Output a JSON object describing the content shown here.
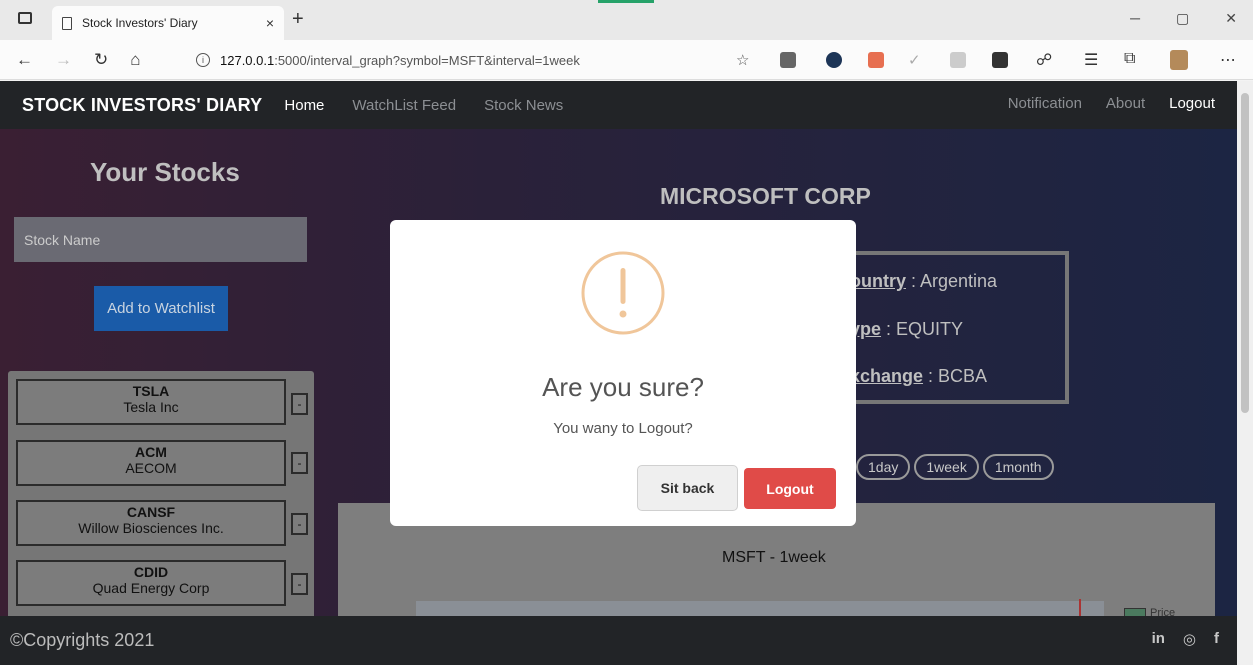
{
  "browser": {
    "tab_title": "Stock Investors' Diary",
    "tab_close": "×",
    "new_tab": "+",
    "url_host": "127.0.0.1",
    "url_path": ":5000/interval_graph?symbol=MSFT&interval=1week",
    "min": "─",
    "max": "▢",
    "close": "✕"
  },
  "navbar": {
    "brand": "STOCK INVESTORS' DIARY",
    "home": "Home",
    "watchlist_feed": "WatchList Feed",
    "stock_news": "Stock News",
    "notification": "Notification",
    "about": "About",
    "logout": "Logout"
  },
  "sidebar": {
    "title": "Your Stocks",
    "input_placeholder": "Stock Name",
    "add_button": "Add to Watchlist",
    "remove_label": "-",
    "items": [
      {
        "symbol": "TSLA",
        "name": "Tesla Inc"
      },
      {
        "symbol": "ACM",
        "name": "AECOM"
      },
      {
        "symbol": "CANSF",
        "name": "Willow Biosciences Inc."
      },
      {
        "symbol": "CDID",
        "name": "Quad Energy Corp"
      }
    ]
  },
  "stock": {
    "company": "MICROSOFT CORP",
    "country_key": "ountry",
    "country_val": " : Argentina",
    "type_key": "ype",
    "type_val": " : EQUITY",
    "exchange_key": "xchange",
    "exchange_val": " : BCBA",
    "intervals": [
      "1day",
      "1week",
      "1month"
    ]
  },
  "chart": {
    "title": "MSFT - 1week",
    "legend": "Price"
  },
  "footer": {
    "copyright": "©Copyrights 2021",
    "social": [
      "in",
      "◎",
      "f"
    ]
  },
  "modal": {
    "title": "Are you sure?",
    "text": "You wany to Logout?",
    "cancel": "Sit back",
    "confirm": "Logout"
  },
  "colors": {
    "brand_blue": "#1a5ba8",
    "confirm_red": "#e04b48",
    "warning_orange": "#f0c69a"
  }
}
